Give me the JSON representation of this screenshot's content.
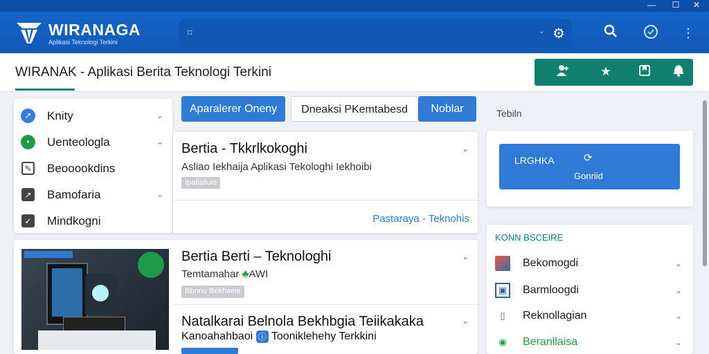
{
  "window": {
    "minimize": "—",
    "maximize": "☐",
    "close": "✕"
  },
  "app": {
    "name": "WIRANAGA",
    "tagline": "Aplikasi Teknologi Terkini"
  },
  "search": {
    "icon": "search-icon",
    "chevron": "⌄",
    "settings_icon": "gear-icon"
  },
  "topbar_icons": [
    "search-icon",
    "help-icon",
    "more-icon"
  ],
  "page": {
    "title": "WIRANAK  - Aplikasi Berita Teknologi Terkini"
  },
  "actions": [
    "add-user-icon",
    "star-icon",
    "bookmark-icon",
    "bell-icon"
  ],
  "sidebar": {
    "items": [
      {
        "label": "Knity",
        "icon": "arrow-icon",
        "color": "#2f80e0",
        "chevron": true
      },
      {
        "label": "Uenteologla",
        "icon": "check-circle-icon",
        "color": "#1f9a46",
        "chevron": true
      },
      {
        "label": "Beooookdins",
        "icon": "edit-icon",
        "color": "#444444",
        "chevron": false
      },
      {
        "label": "Bamofaria",
        "icon": "expand-icon",
        "color": "#444444",
        "chevron": true
      },
      {
        "label": "Mindkogni",
        "icon": "checkbox-icon",
        "color": "#444444",
        "chevron": false
      }
    ]
  },
  "tabs": [
    "Aparalerer Oneny",
    "Dneaksi PKemtabesd",
    "Noblar"
  ],
  "articles": [
    {
      "title": "Bertia - Tkkrlkokoghi",
      "subtitle": "Asliao Iekhaija Aplikasi Tekologhi Iekhoibi",
      "chip": "Ipaltaliuie",
      "link": "Pastaraya - Teknohis"
    },
    {
      "title": "Bertia Berti – Teknologhi",
      "subtitle": "Temtamahar",
      "subtitle_extra": "AWI",
      "chip": "Bbnnu Bekhaeie"
    },
    {
      "title": "Natalkarai Belnola Bekhbgia Teiikakaka",
      "subtitle_pre": "Kanoahahbaoi",
      "subtitle": "Tooniklehehy Terkkini"
    }
  ],
  "right": {
    "section_title": "Tebiln",
    "promo_label": "LRGHKA",
    "promo_sub": "Gonriid",
    "list_title": "KONN BSCEIRE",
    "items": [
      {
        "label": "Bekomogdi",
        "icon": "photo-icon"
      },
      {
        "label": "Barmloogdi",
        "icon": "image-icon"
      },
      {
        "label": "Reknollagian",
        "icon": "file-icon"
      },
      {
        "label": "Beranllaisa",
        "icon": "globe-icon",
        "highlight": true
      }
    ]
  },
  "colors": {
    "primary": "#1565c8",
    "accent": "#12806f",
    "tab_active": "#2f7bd6",
    "promo": "#2f7bd6",
    "green_text": "#1f9a46"
  }
}
